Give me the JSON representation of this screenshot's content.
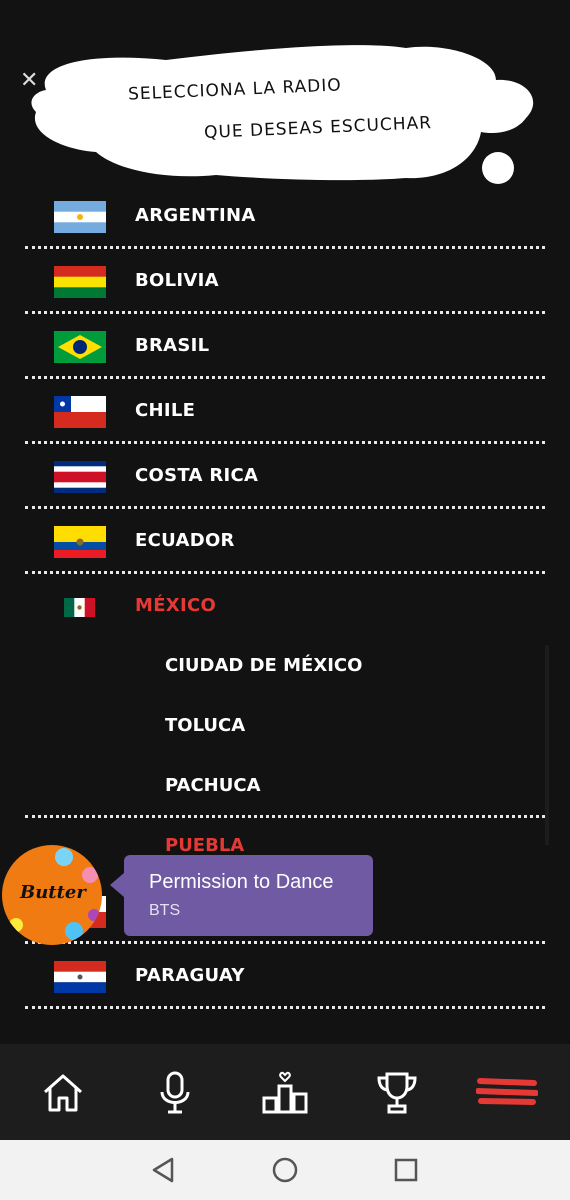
{
  "header": {
    "close_icon": "close-icon",
    "bubble_line1": "SELECCIONA LA RADIO",
    "bubble_line2": "QUE DESEAS ESCUCHAR"
  },
  "countries": [
    {
      "label": "ARGENTINA",
      "flag": "argentina-flag-icon"
    },
    {
      "label": "BOLIVIA",
      "flag": "bolivia-flag-icon"
    },
    {
      "label": "BRASIL",
      "flag": "brazil-flag-icon"
    },
    {
      "label": "CHILE",
      "flag": "chile-flag-icon"
    },
    {
      "label": "COSTA RICA",
      "flag": "costa-rica-flag-icon"
    },
    {
      "label": "ECUADOR",
      "flag": "ecuador-flag-icon"
    },
    {
      "label": "MÉXICO",
      "flag": "mexico-flag-icon",
      "selected": true
    },
    {
      "label": "PARAGUAY",
      "flag": "paraguay-flag-icon"
    }
  ],
  "mexico_cities": [
    {
      "label": "CIUDAD DE MÉXICO"
    },
    {
      "label": "TOLUCA"
    },
    {
      "label": "PACHUCA"
    },
    {
      "label": "PUEBLA",
      "active": true
    }
  ],
  "now_playing": {
    "cover_text": "Butter",
    "title": "Permission to Dance",
    "artist": "BTS"
  },
  "bottom_nav": [
    {
      "icon": "home-icon"
    },
    {
      "icon": "microphone-icon"
    },
    {
      "icon": "ranking-icon"
    },
    {
      "icon": "trophy-icon"
    },
    {
      "icon": "menu-icon",
      "active": true
    }
  ],
  "system_bar": [
    "back-icon",
    "home-circle-icon",
    "recents-icon"
  ],
  "colors": {
    "background": "#121212",
    "accent_red": "#e53935",
    "tooltip_purple": "#6f5aa3",
    "nav_bg": "#1d1d1d"
  }
}
